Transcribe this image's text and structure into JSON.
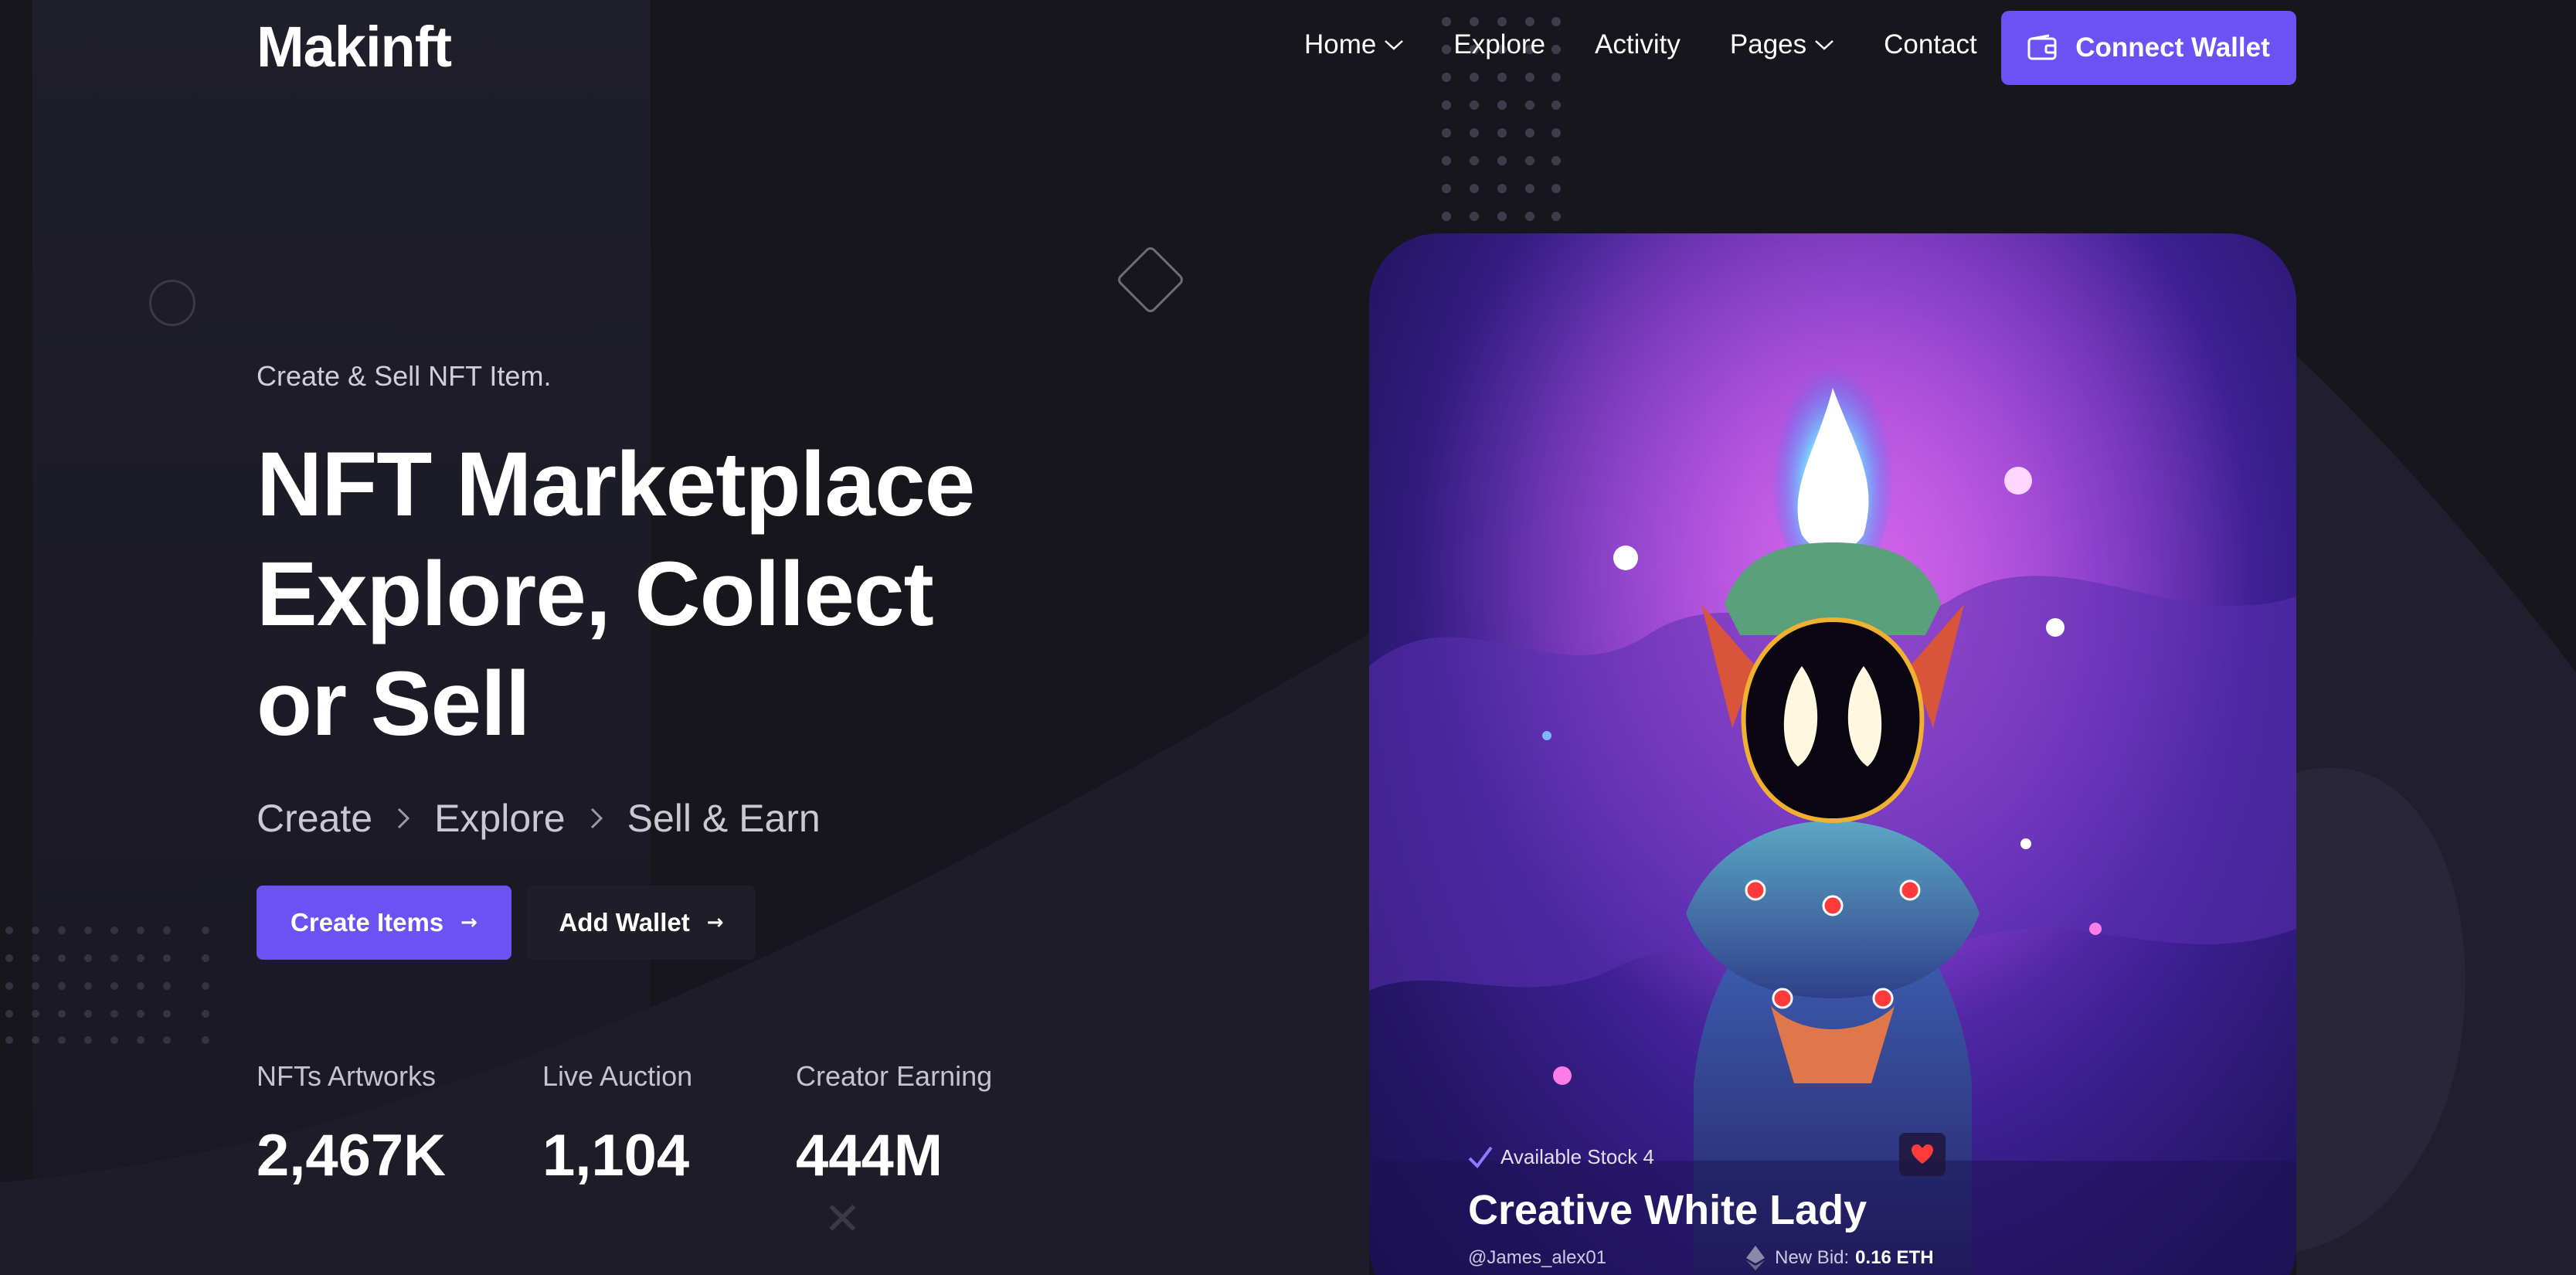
{
  "header": {
    "logo": "Makinft",
    "nav": [
      {
        "label": "Home",
        "has_dropdown": true
      },
      {
        "label": "Explore",
        "has_dropdown": false
      },
      {
        "label": "Activity",
        "has_dropdown": false
      },
      {
        "label": "Pages",
        "has_dropdown": true
      },
      {
        "label": "Contact",
        "has_dropdown": false
      }
    ],
    "connect_wallet_label": "Connect Wallet"
  },
  "hero": {
    "subtitle": "Create & Sell NFT Item.",
    "title_lines": [
      "NFT Marketplace",
      "Explore, Collect",
      "or Sell"
    ],
    "steps": [
      "Create",
      "Explore",
      "Sell & Earn"
    ],
    "primary_button": "Create Items",
    "secondary_button": "Add Wallet"
  },
  "stats": [
    {
      "label": "NFTs Artworks",
      "value": "2,467K"
    },
    {
      "label": "Live Auction",
      "value": "1,104"
    },
    {
      "label": "Creator Earning",
      "value": "444M"
    }
  ],
  "nft_card": {
    "stock": "Available Stock 4",
    "title": "Creative White Lady",
    "owner": "@James_alex01",
    "bid_label": "New Bid:",
    "bid_value": "0.16 ETH"
  },
  "colors": {
    "background": "#17161d",
    "accent": "#6c52f2",
    "text": "#ffffff",
    "muted_text": "#c4c4ce",
    "heart": "#ff3b3b"
  },
  "icons": {
    "nav_dropdown": "chevron-down-icon",
    "connect_wallet": "wallet-icon",
    "step_separator": "chevron-right-icon",
    "button_arrow": "arrow-right-icon",
    "stock": "check-icon",
    "favorite": "heart-icon",
    "currency": "ethereum-icon"
  }
}
